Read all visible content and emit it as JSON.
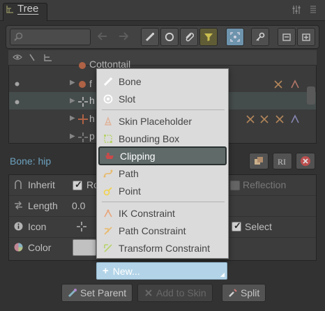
{
  "header": {
    "tab_label": "Tree"
  },
  "search": {
    "placeholder": ""
  },
  "tree_rows": [
    {
      "label": "Cottontail"
    },
    {
      "label": "f"
    },
    {
      "label": "h"
    },
    {
      "label": "h"
    },
    {
      "label": "p"
    }
  ],
  "selection": {
    "title": "Bone: hip"
  },
  "props": {
    "inherit_label": "Inherit",
    "inherit_rotation": "Ro",
    "inherit_reflection": "Reflection",
    "length_label": "Length",
    "length_value": "0.0",
    "icon_label": "Icon",
    "select_label": "Select",
    "color_label": "Color"
  },
  "menu": {
    "items": [
      {
        "label": "Bone",
        "icon": "bone-icon"
      },
      {
        "label": "Slot",
        "icon": "slot-icon"
      },
      {
        "label": "Skin Placeholder",
        "icon": "skin-placeholder-icon"
      },
      {
        "label": "Bounding Box",
        "icon": "bounding-box-icon"
      },
      {
        "label": "Clipping",
        "icon": "clipping-icon",
        "highlighted": true
      },
      {
        "label": "Path",
        "icon": "path-icon"
      },
      {
        "label": "Point",
        "icon": "point-icon"
      },
      {
        "label": "IK Constraint",
        "icon": "ik-constraint-icon"
      },
      {
        "label": "Path Constraint",
        "icon": "path-constraint-icon"
      },
      {
        "label": "Transform Constraint",
        "icon": "transform-constraint-icon"
      }
    ]
  },
  "new_button": {
    "label": "New..."
  },
  "bottom_buttons": {
    "set_parent": "Set Parent",
    "add_to_skin": "Add to Skin",
    "split": "Split"
  },
  "colors": {
    "accent_blue": "#7bb8d9",
    "menu_highlight": "#5f6a69",
    "new_button": "#b3d4e8"
  }
}
